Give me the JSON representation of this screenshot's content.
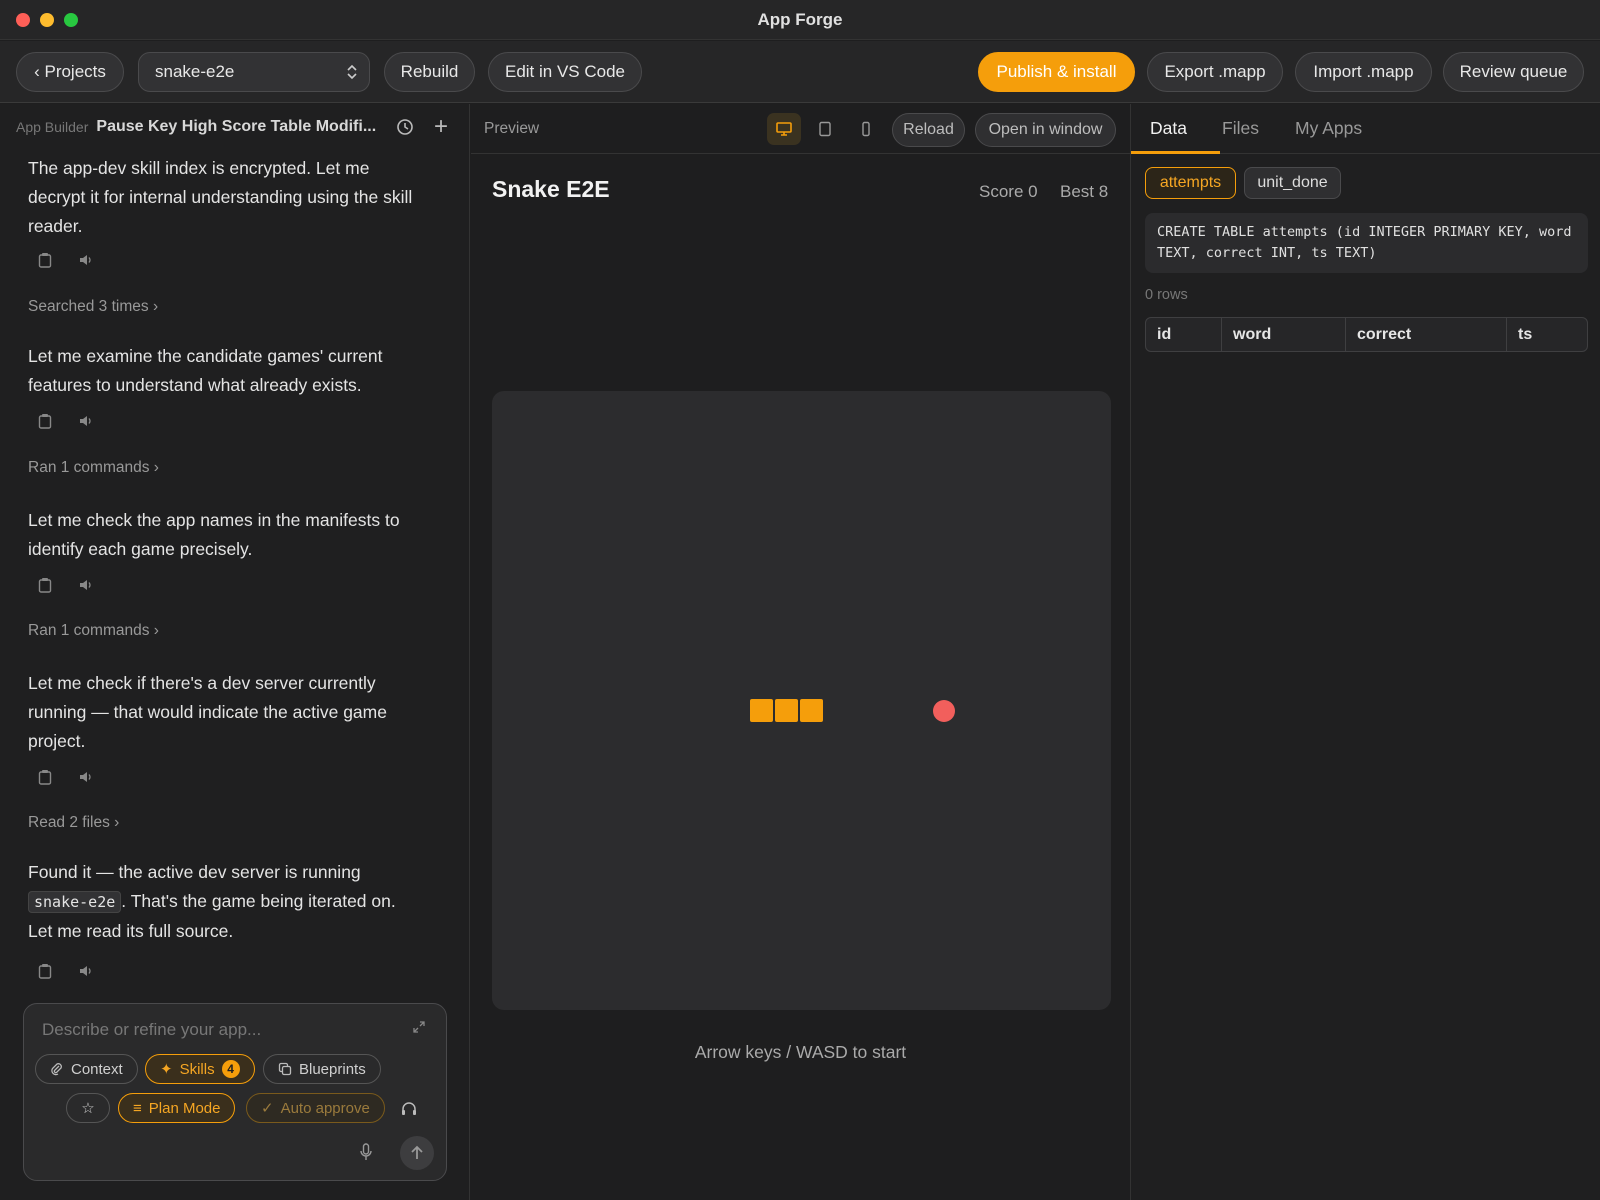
{
  "window": {
    "title": "App Forge"
  },
  "toolbar": {
    "projects_label": "‹ Projects",
    "project_select": "snake-e2e",
    "rebuild_label": "Rebuild",
    "edit_vscode_label": "Edit in VS Code",
    "publish_label": "Publish & install",
    "export_label": "Export .mapp",
    "import_label": "Import .mapp",
    "review_label": "Review queue"
  },
  "left": {
    "app_label": "App Builder",
    "session_title": "Pause Key High Score Table Modifi...",
    "messages": [
      "The app-dev skill index is encrypted. Let me decrypt it for internal understanding using the skill reader.",
      "Let me examine the candidate games' current features to understand what already exists.",
      "Let me check the app names in the manifests to identify each game precisely.",
      "Let me check if there's a dev server currently running — that would indicate the active game project."
    ],
    "last_message": {
      "before": "Found it — the active dev server is running",
      "code": "snake-e2e",
      "after": ". That's the game being iterated on. Let me read its full source."
    },
    "steps": [
      "Searched 3 times",
      "Ran 1 commands",
      "Ran 1 commands",
      "Read 2 files"
    ],
    "composer": {
      "placeholder": "Describe or refine your app...",
      "context_label": "Context",
      "skills_label": "Skills",
      "skills_count": "4",
      "blueprints_label": "Blueprints",
      "plan_mode_label": "Plan Mode",
      "auto_approve_label": "Auto approve"
    }
  },
  "preview": {
    "label": "Preview",
    "reload_label": "Reload",
    "open_window_label": "Open in window",
    "game_title": "Snake E2E",
    "score_text": "Score 0",
    "best_text": "Best 8",
    "hint": "Arrow keys / WASD to start"
  },
  "right": {
    "tabs": [
      "Data",
      "Files",
      "My Apps"
    ],
    "tables": [
      "attempts",
      "unit_done"
    ],
    "sql": "CREATE TABLE attempts (id INTEGER PRIMARY KEY, word TEXT, correct INT, ts TEXT)",
    "rows_text": "0 rows",
    "columns": [
      "id",
      "word",
      "correct",
      "ts"
    ]
  },
  "colors": {
    "accent": "#f59e0b",
    "food": "#f25f5c",
    "background": "#1e1e1f"
  }
}
